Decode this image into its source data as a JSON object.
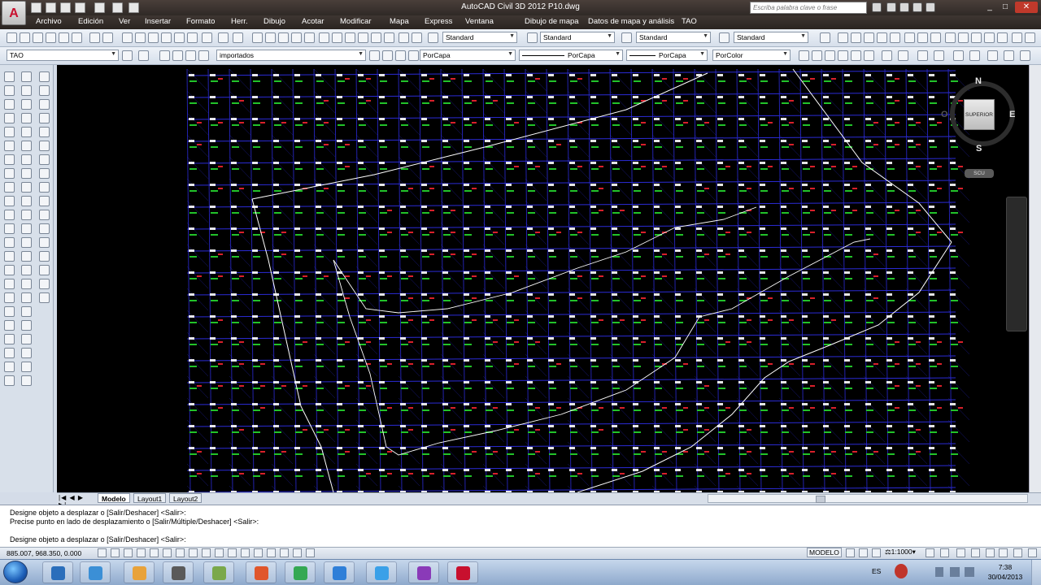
{
  "window": {
    "title": "AutoCAD Civil 3D 2012    P10.dwg",
    "search_placeholder": "Escriba palabra clave o frase"
  },
  "menu": [
    "Archivo",
    "Edición",
    "Ver",
    "Insertar",
    "Formato",
    "Herr.",
    "Dibujo",
    "Acotar",
    "Modificar",
    "Mapa",
    "Express",
    "Ventana",
    "Dibujo de mapa",
    "Datos de mapa y análisis",
    "TAO"
  ],
  "styles_toolbar": {
    "text_style": "Standard",
    "dim_style": "Standard",
    "table_style": "Standard",
    "mleader_style": "Standard"
  },
  "layers_toolbar": {
    "workspace": "TAO",
    "layer": "importados",
    "color": "PorCapa",
    "linetype": "PorCapa",
    "lineweight": "PorCapa",
    "plotstyle": "PorColor"
  },
  "viewcube": {
    "north": "N",
    "south": "S",
    "east": "E",
    "west": "O",
    "face": "SUPERIOR",
    "wcs": "SCU"
  },
  "tabs": [
    "Modelo",
    "Layout1",
    "Layout2"
  ],
  "command_lines": [
    "Designe objeto a desplazar o [Salir/Deshacer] <Salir>:",
    "Precise punto en lado de desplazamiento o [Salir/Múltiple/Deshacer] <Salir>:",
    "",
    "Designe objeto a desplazar o [Salir/Deshacer] <Salir>:"
  ],
  "status": {
    "coordinates": "885.007, 968.350, 0.000",
    "space": "MODELO",
    "scale": "1:1000"
  },
  "taskbar": {
    "language": "ES",
    "time": "7:38",
    "date": "30/04/2013"
  },
  "colors": {
    "background": "#000000",
    "grid": "#2b2bd6",
    "point_labels": "#ffffff",
    "point_desc": "#22c22a",
    "markers": "#d8202a",
    "boundary": "#ffffff"
  }
}
